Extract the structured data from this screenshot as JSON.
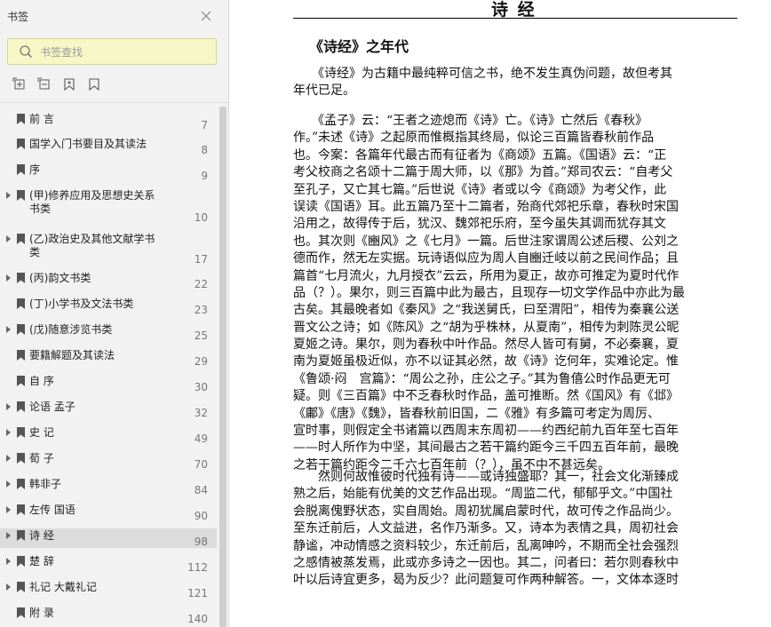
{
  "sidebar": {
    "title": "书签",
    "search_placeholder": "书签查找",
    "bookmarks": [
      {
        "label": "前 言",
        "page": "7",
        "expandable": false,
        "active": false
      },
      {
        "label": "国学入门书要目及其读法",
        "page": "8",
        "expandable": false,
        "active": false
      },
      {
        "label": "序",
        "page": "9",
        "expandable": false,
        "active": false
      },
      {
        "label": "(甲)修养应用及思想史关系书类",
        "page": "10",
        "expandable": true,
        "active": false
      },
      {
        "label": "(乙)政治史及其他文献学书类",
        "page": "17",
        "expandable": true,
        "active": false
      },
      {
        "label": "(丙)韵文书类",
        "page": "22",
        "expandable": true,
        "active": false
      },
      {
        "label": "(丁)小学书及文法书类",
        "page": "23",
        "expandable": false,
        "active": false
      },
      {
        "label": "(戊)随意涉览书类",
        "page": "25",
        "expandable": true,
        "active": false
      },
      {
        "label": "要籍解题及其读法",
        "page": "29",
        "expandable": false,
        "active": false
      },
      {
        "label": "自 序",
        "page": "30",
        "expandable": false,
        "active": false
      },
      {
        "label": "论语 孟子",
        "page": "32",
        "expandable": true,
        "active": false
      },
      {
        "label": "史 记",
        "page": "49",
        "expandable": true,
        "active": false
      },
      {
        "label": "荀 子",
        "page": "70",
        "expandable": true,
        "active": false
      },
      {
        "label": "韩非子",
        "page": "84",
        "expandable": true,
        "active": false
      },
      {
        "label": "左传 国语",
        "page": "90",
        "expandable": true,
        "active": false
      },
      {
        "label": "诗 经",
        "page": "98",
        "expandable": true,
        "active": true
      },
      {
        "label": "楚 辞",
        "page": "112",
        "expandable": true,
        "active": false
      },
      {
        "label": "礼记 大戴礼记",
        "page": "121",
        "expandable": true,
        "active": false
      },
      {
        "label": "附 录",
        "page": "140",
        "expandable": false,
        "active": false
      }
    ]
  },
  "document": {
    "running_title": "诗 经",
    "section_title": "《诗经》之年代",
    "paragraphs": [
      {
        "lines": [
          "　　《诗经》为古籍中最纯粹可信之书，绝不发生真伪问题，故但考其",
          "年代已足。"
        ]
      },
      {
        "lines": [
          "　　《孟子》云：“王者之迹熄而《诗》亡。《诗》亡然后《春秋》",
          "作。”未述《诗》之起原而惟概指其终局，似论三百篇皆春秋前作品",
          "也。今案：各篇年代最古而有征者为《商颂》五篇。《国语》云：“正",
          "考父校商之名颂十二篇于周大师，以《那》为首。”郑司农云：“自考父",
          "至孔子，又亡其七篇。”后世说《诗》者或以今《商颂》为考父作，此",
          "误读《国语》耳。此五篇乃至十二篇者，殆商代郊祀乐章，春秋时宋国",
          "沿用之，故得传于后，犹汉、魏郊祀乐府，至今虽失其调而犹存其文",
          "也。其次则《豳风》之《七月》一篇。后世注家谓周公述后稷、公刘之",
          "德而作，然无左实据。玩诗语似应为周人自豳迁岐以前之民间作品；且",
          "篇首“七月流火，九月授衣”云云，所用为夏正，故亦可推定为夏时代作",
          "品（？）。果尔，则三百篇中此为最古，且现存一切文学作品中亦此为最",
          "古矣。其最晚者如《秦风》之“我送舅氏，曰至渭阳”，相传为秦襄公送",
          "晋文公之诗；如《陈风》之“胡为乎株林，从夏南”，相传为刺陈灵公昵",
          "夏姬之诗。果尔，则为春秋中叶作品。然尽人皆可有舅，不必秦襄，夏",
          "南为夏姬虽极近似，亦不以证其必然，故《诗》讫何年，实难论定。惟",
          "《鲁颂·闷　宫篇》：“周公之孙，庄公之子。”其为鲁僖公时作品更无可",
          "疑。则《三百篇》中不乏春秋时作品，盖可推断。然《国风》有《邶》",
          "《鄘》《唐》《魏》，皆春秋前旧国，二《雅》有多篇可考定为周厉、",
          "宣时事，则假定全书诸篇以西周末东周初——约西纪前九百年至七百年",
          "——时人所作为中坚，其间最古之若干篇约距今三千四五百年前，最晚",
          "之若干篇约距今二千六七百年前（？），虽不中不甚远矣。"
        ]
      },
      {
        "lines": [
          "　　然则何故惟彼时代独有诗——或诗独盛耶？其一，社会文化渐臻成",
          "熟之后，始能有优美的文艺作品出现。“周监二代，郁郁乎文。”中国社",
          "会脱离傀野状态，实自周始。周初犹属启蒙时代，故可传之作品尚少。",
          "至东迁前后，人文益进，名作乃渐多。又，诗本为表情之具，周初社会",
          "静谧，冲动情感之资料较少，东迁前后，乱离呻吟，不期而全社会强烈",
          "之感情被蒸发焉，此或亦多诗之一因也。其二，问者曰：若尔则春秋中",
          "叶以后诗宜更多，曷为反少？此问题复可作两种解答。一，文体本逐时"
        ]
      }
    ]
  }
}
